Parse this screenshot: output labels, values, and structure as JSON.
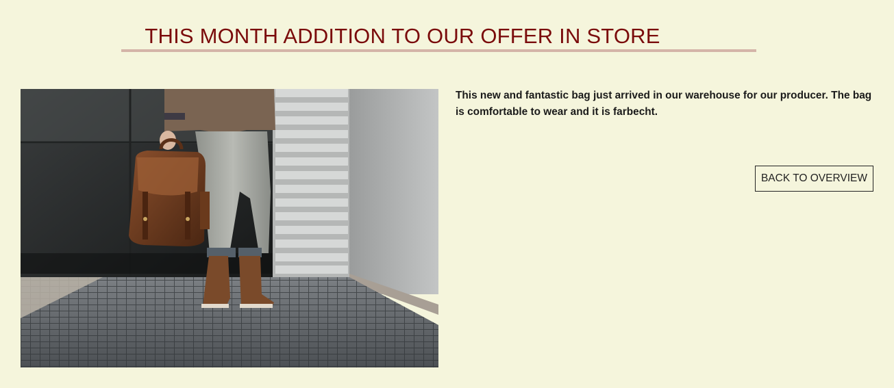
{
  "heading": {
    "title": "THIS MONTH ADDITION TO OUR OFFER IN STORE"
  },
  "product": {
    "description": "This new and fantastic bag just arrived in our warehouse for our producer. The bag is comfortable to wear and it is farbecht."
  },
  "actions": {
    "back_label": "BACK TO OVERVIEW"
  },
  "colors": {
    "background": "#f5f5dc",
    "title": "#7a0b0b",
    "rule": "#d4b4a8",
    "text": "#1a1a1a"
  }
}
